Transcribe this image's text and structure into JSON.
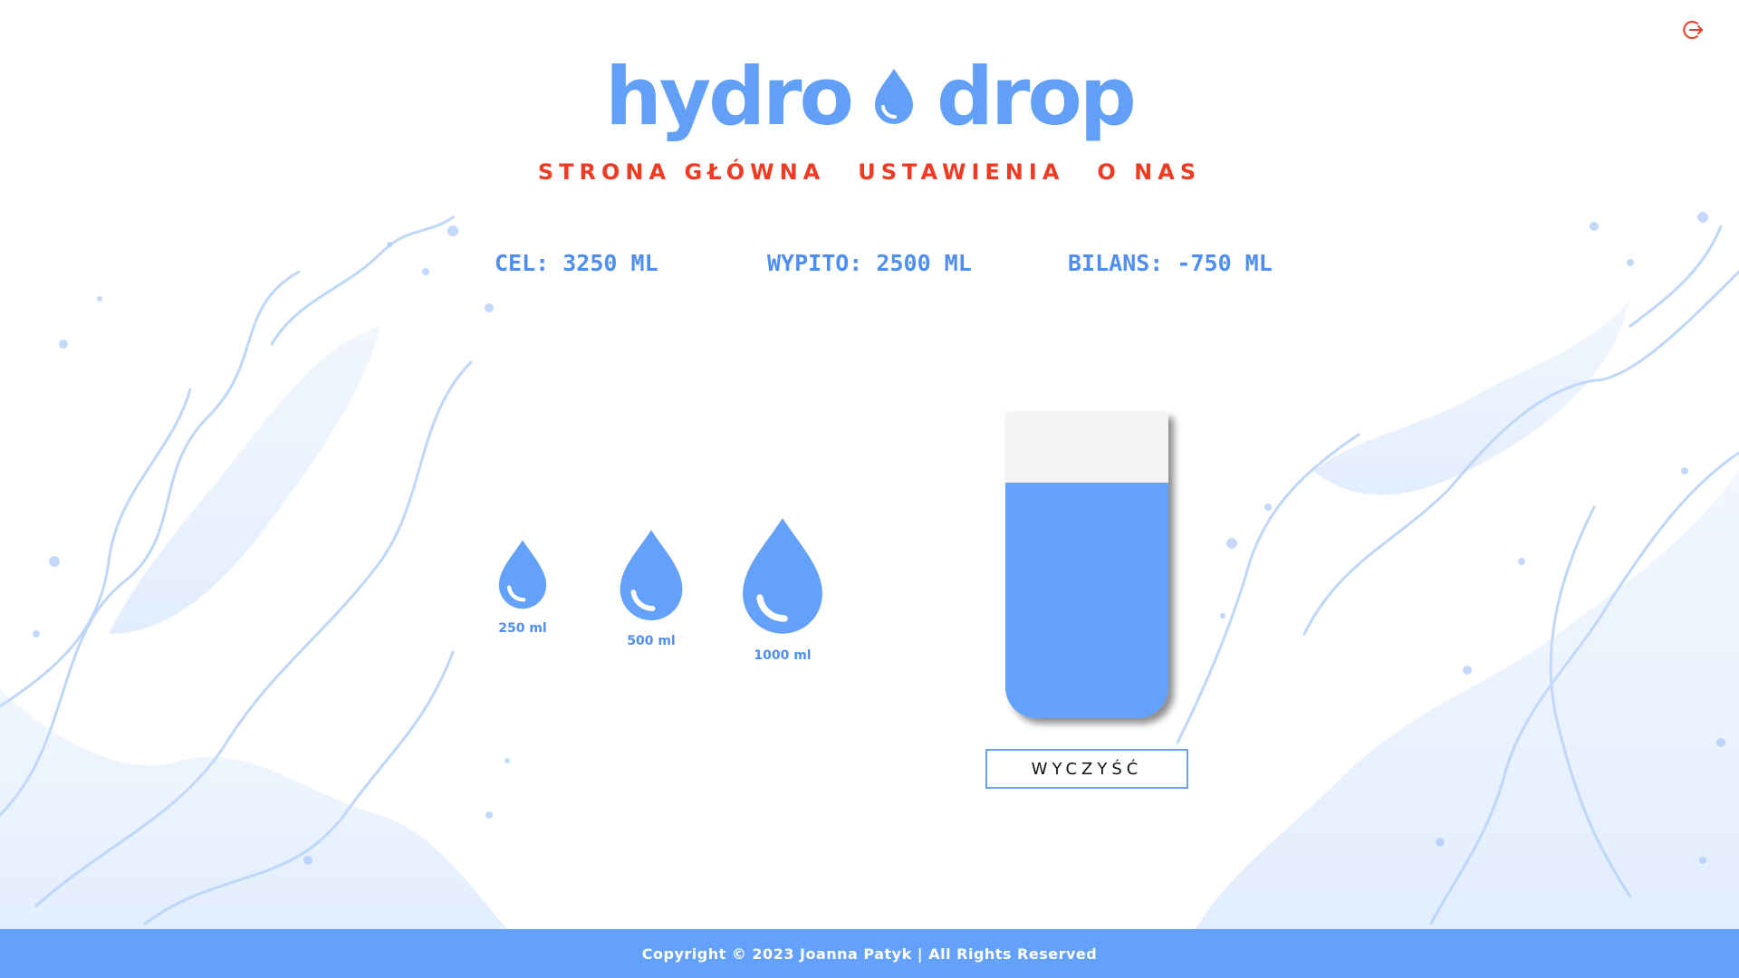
{
  "brand": {
    "word1": "hydro",
    "word2": "drop",
    "color": "#62a0f8"
  },
  "nav": {
    "items": [
      "STRONA GŁÓWNA",
      "USTAWIENIA",
      "O NAS"
    ],
    "color": "#ef3b24"
  },
  "stats": {
    "goal": "CEL: 3250 ML",
    "drunk": "WYPITO: 2500 ML",
    "balance": "BILANS: -750 ML"
  },
  "drops": [
    {
      "label": "250 ml"
    },
    {
      "label": "500 ml"
    },
    {
      "label": "1000 ml"
    }
  ],
  "glass": {
    "fill_fraction": 0.77,
    "water_color": "#64a1fa"
  },
  "clear_button": {
    "label": "WYCZYŚĆ"
  },
  "footer": {
    "text": "Copyright © 2023 Joanna Patyk | All Rights Reserved",
    "color": "#64a1fa"
  },
  "icons": {
    "logout": "logout-icon",
    "logo_drop": "water-drop-icon",
    "drop_button": "water-drop-icon"
  }
}
